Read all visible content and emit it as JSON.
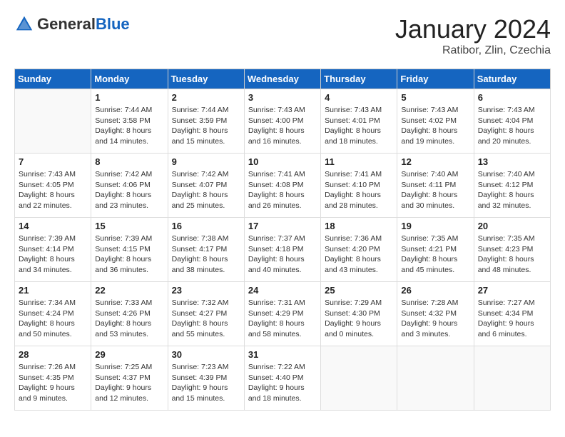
{
  "header": {
    "logo_general": "General",
    "logo_blue": "Blue",
    "month_title": "January 2024",
    "location": "Ratibor, Zlin, Czechia"
  },
  "calendar": {
    "days_of_week": [
      "Sunday",
      "Monday",
      "Tuesday",
      "Wednesday",
      "Thursday",
      "Friday",
      "Saturday"
    ],
    "weeks": [
      [
        {
          "day": "",
          "info": ""
        },
        {
          "day": "1",
          "info": "Sunrise: 7:44 AM\nSunset: 3:58 PM\nDaylight: 8 hours\nand 14 minutes."
        },
        {
          "day": "2",
          "info": "Sunrise: 7:44 AM\nSunset: 3:59 PM\nDaylight: 8 hours\nand 15 minutes."
        },
        {
          "day": "3",
          "info": "Sunrise: 7:43 AM\nSunset: 4:00 PM\nDaylight: 8 hours\nand 16 minutes."
        },
        {
          "day": "4",
          "info": "Sunrise: 7:43 AM\nSunset: 4:01 PM\nDaylight: 8 hours\nand 18 minutes."
        },
        {
          "day": "5",
          "info": "Sunrise: 7:43 AM\nSunset: 4:02 PM\nDaylight: 8 hours\nand 19 minutes."
        },
        {
          "day": "6",
          "info": "Sunrise: 7:43 AM\nSunset: 4:04 PM\nDaylight: 8 hours\nand 20 minutes."
        }
      ],
      [
        {
          "day": "7",
          "info": "Sunrise: 7:43 AM\nSunset: 4:05 PM\nDaylight: 8 hours\nand 22 minutes."
        },
        {
          "day": "8",
          "info": "Sunrise: 7:42 AM\nSunset: 4:06 PM\nDaylight: 8 hours\nand 23 minutes."
        },
        {
          "day": "9",
          "info": "Sunrise: 7:42 AM\nSunset: 4:07 PM\nDaylight: 8 hours\nand 25 minutes."
        },
        {
          "day": "10",
          "info": "Sunrise: 7:41 AM\nSunset: 4:08 PM\nDaylight: 8 hours\nand 26 minutes."
        },
        {
          "day": "11",
          "info": "Sunrise: 7:41 AM\nSunset: 4:10 PM\nDaylight: 8 hours\nand 28 minutes."
        },
        {
          "day": "12",
          "info": "Sunrise: 7:40 AM\nSunset: 4:11 PM\nDaylight: 8 hours\nand 30 minutes."
        },
        {
          "day": "13",
          "info": "Sunrise: 7:40 AM\nSunset: 4:12 PM\nDaylight: 8 hours\nand 32 minutes."
        }
      ],
      [
        {
          "day": "14",
          "info": "Sunrise: 7:39 AM\nSunset: 4:14 PM\nDaylight: 8 hours\nand 34 minutes."
        },
        {
          "day": "15",
          "info": "Sunrise: 7:39 AM\nSunset: 4:15 PM\nDaylight: 8 hours\nand 36 minutes."
        },
        {
          "day": "16",
          "info": "Sunrise: 7:38 AM\nSunset: 4:17 PM\nDaylight: 8 hours\nand 38 minutes."
        },
        {
          "day": "17",
          "info": "Sunrise: 7:37 AM\nSunset: 4:18 PM\nDaylight: 8 hours\nand 40 minutes."
        },
        {
          "day": "18",
          "info": "Sunrise: 7:36 AM\nSunset: 4:20 PM\nDaylight: 8 hours\nand 43 minutes."
        },
        {
          "day": "19",
          "info": "Sunrise: 7:35 AM\nSunset: 4:21 PM\nDaylight: 8 hours\nand 45 minutes."
        },
        {
          "day": "20",
          "info": "Sunrise: 7:35 AM\nSunset: 4:23 PM\nDaylight: 8 hours\nand 48 minutes."
        }
      ],
      [
        {
          "day": "21",
          "info": "Sunrise: 7:34 AM\nSunset: 4:24 PM\nDaylight: 8 hours\nand 50 minutes."
        },
        {
          "day": "22",
          "info": "Sunrise: 7:33 AM\nSunset: 4:26 PM\nDaylight: 8 hours\nand 53 minutes."
        },
        {
          "day": "23",
          "info": "Sunrise: 7:32 AM\nSunset: 4:27 PM\nDaylight: 8 hours\nand 55 minutes."
        },
        {
          "day": "24",
          "info": "Sunrise: 7:31 AM\nSunset: 4:29 PM\nDaylight: 8 hours\nand 58 minutes."
        },
        {
          "day": "25",
          "info": "Sunrise: 7:29 AM\nSunset: 4:30 PM\nDaylight: 9 hours\nand 0 minutes."
        },
        {
          "day": "26",
          "info": "Sunrise: 7:28 AM\nSunset: 4:32 PM\nDaylight: 9 hours\nand 3 minutes."
        },
        {
          "day": "27",
          "info": "Sunrise: 7:27 AM\nSunset: 4:34 PM\nDaylight: 9 hours\nand 6 minutes."
        }
      ],
      [
        {
          "day": "28",
          "info": "Sunrise: 7:26 AM\nSunset: 4:35 PM\nDaylight: 9 hours\nand 9 minutes."
        },
        {
          "day": "29",
          "info": "Sunrise: 7:25 AM\nSunset: 4:37 PM\nDaylight: 9 hours\nand 12 minutes."
        },
        {
          "day": "30",
          "info": "Sunrise: 7:23 AM\nSunset: 4:39 PM\nDaylight: 9 hours\nand 15 minutes."
        },
        {
          "day": "31",
          "info": "Sunrise: 7:22 AM\nSunset: 4:40 PM\nDaylight: 9 hours\nand 18 minutes."
        },
        {
          "day": "",
          "info": ""
        },
        {
          "day": "",
          "info": ""
        },
        {
          "day": "",
          "info": ""
        }
      ]
    ]
  }
}
